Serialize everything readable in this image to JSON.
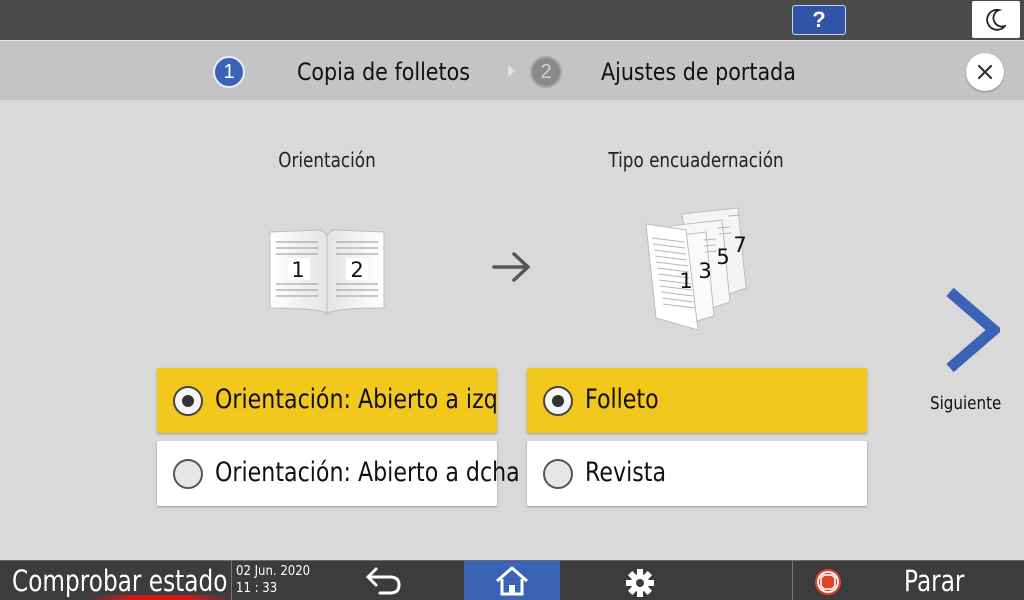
{
  "topbar": {
    "help_label": "?"
  },
  "steps": [
    {
      "number": "1",
      "label": "Copia de folletos",
      "active": true
    },
    {
      "number": "2",
      "label": "Ajustes de portada",
      "active": false
    }
  ],
  "orientation": {
    "title": "Orientación",
    "page_numbers": [
      "1",
      "2"
    ],
    "options": [
      {
        "label": "Orientación: Abierto a izq",
        "selected": true
      },
      {
        "label": "Orientación: Abierto a dcha",
        "selected": false
      }
    ]
  },
  "binding": {
    "title": "Tipo encuadernación",
    "page_numbers": [
      "1",
      "3",
      "5",
      "7"
    ],
    "options": [
      {
        "label": "Folleto",
        "selected": true
      },
      {
        "label": "Revista",
        "selected": false
      }
    ]
  },
  "next": {
    "label": "Siguiente"
  },
  "bottombar": {
    "status_label": "Comprobar estado",
    "date": "02 Jun. 2020",
    "time": "11 : 33",
    "stop_label": "Parar"
  },
  "colors": {
    "accent_blue": "#3a62b5",
    "selected_yellow": "#f2c81c",
    "topbar": "#4a4a4a",
    "bottombar": "#3c3c3c",
    "stop_red": "#e0452a"
  },
  "icons": [
    "help-icon",
    "moon-icon",
    "close-icon",
    "arrow-right-icon",
    "chevron-right-icon",
    "back-icon",
    "home-icon",
    "gear-icon",
    "stop-icon"
  ]
}
